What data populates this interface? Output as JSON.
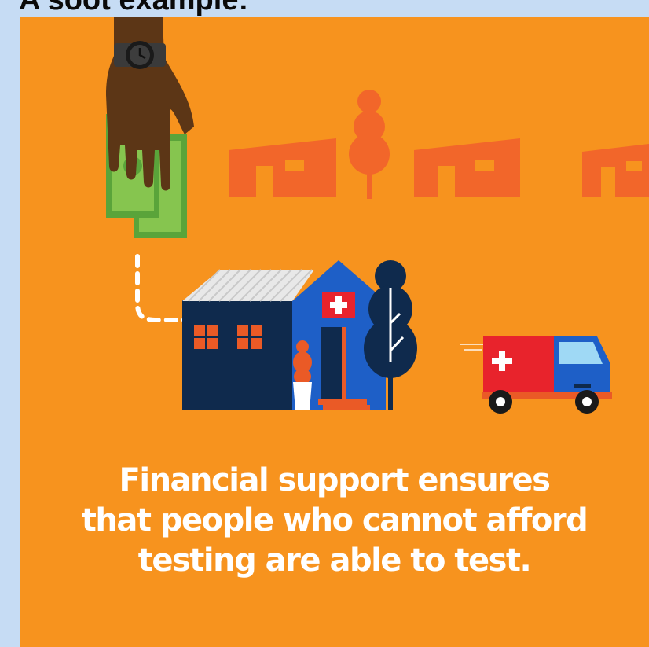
{
  "header": {
    "title": "A soot example:"
  },
  "illustration": {
    "elements": [
      "hand-with-watch",
      "banknotes",
      "row-of-houses",
      "trees",
      "health-clinic",
      "ambulance",
      "dashed-route"
    ],
    "colors": {
      "background": "#f7931e",
      "houses_row": "#f2662a",
      "clinic_wall": "#0f2a4d",
      "clinic_front": "#1e5fc7",
      "cross_box": "#e8232c",
      "money": "#74b843",
      "hand": "#5c3616"
    }
  },
  "caption": {
    "line1": "Financial support ensures",
    "line2": "that people who cannot afford",
    "line3": "testing are able to test."
  }
}
